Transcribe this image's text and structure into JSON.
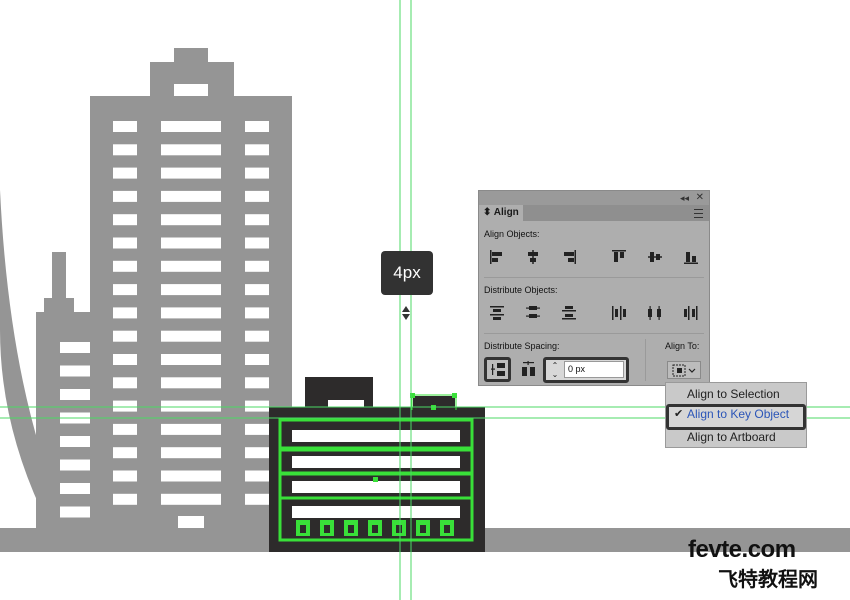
{
  "tooltip": {
    "text": "4px"
  },
  "align_panel": {
    "tab_title": "Align",
    "collapse_glyph": "◂◂",
    "close_glyph": "✕",
    "align_objects_label": "Align Objects:",
    "distribute_objects_label": "Distribute Objects:",
    "distribute_spacing_label": "Distribute Spacing:",
    "align_to_label": "Align To:",
    "spacing_value": "0 px",
    "spin_up": "⌃",
    "spin_down": "⌄"
  },
  "dropdown": {
    "items": [
      {
        "label": "Align to Selection",
        "checked": false
      },
      {
        "label": "Align to Key Object",
        "checked": true
      },
      {
        "label": "Align to Artboard",
        "checked": false
      }
    ],
    "check_glyph": "✔"
  },
  "watermark": {
    "line1": "fevte.com",
    "line2": "飞特教程网"
  },
  "colors": {
    "building_gray": "#959595",
    "building_dark": "#2d2b2b",
    "guide_green": "#4cd964",
    "selection_green": "#39e039",
    "panel_bg": "#aeaeae",
    "highlight_blue": "#2b55b8"
  }
}
